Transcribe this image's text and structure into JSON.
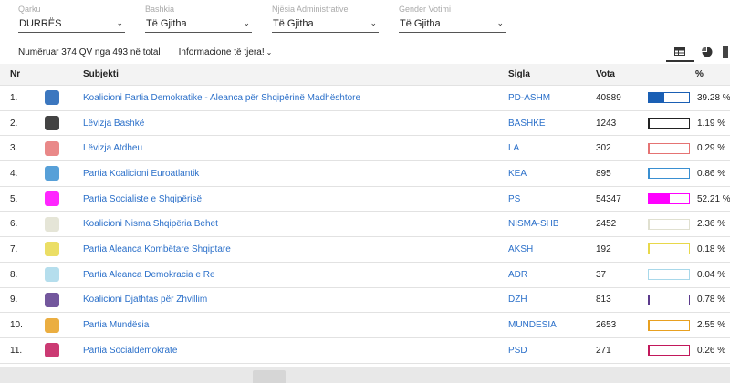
{
  "filters": [
    {
      "label": "Qarku",
      "value": "DURRËS"
    },
    {
      "label": "Bashkia",
      "value": "Të Gjitha"
    },
    {
      "label": "Njësia Administrative",
      "value": "Të Gjitha"
    },
    {
      "label": "Gender Votimi",
      "value": "Të Gjitha"
    }
  ],
  "info": {
    "count_text": "Numëruar 374 QV nga 493 në total",
    "more_label": "Informacione të tjera!"
  },
  "views": [
    "table-view-icon",
    "pie-chart-icon"
  ],
  "table": {
    "headers": {
      "nr": "Nr",
      "subjekti": "Subjekti",
      "sigla": "Sigla",
      "vota": "Vota",
      "pct": "%"
    },
    "rows": [
      {
        "nr": "1.",
        "subjekti": "Koalicioni Partia Demokratike - Aleanca për Shqipërinë Madhështore",
        "sigla": "PD-ASHM",
        "vota": "40889",
        "pct": "39.28 %",
        "share": 0.3928,
        "color": "#1a5fb4",
        "logo": "pd-logo"
      },
      {
        "nr": "2.",
        "subjekti": "Lëvizja Bashkë",
        "sigla": "BASHKE",
        "vota": "1243",
        "pct": "1.19 %",
        "share": 0.0119,
        "color": "#222222",
        "logo": "bashke-logo"
      },
      {
        "nr": "3.",
        "subjekti": "Lëvizja Atdheu",
        "sigla": "LA",
        "vota": "302",
        "pct": "0.29 %",
        "share": 0.0029,
        "color": "#e57373",
        "logo": "la-logo"
      },
      {
        "nr": "4.",
        "subjekti": "Partia Koalicioni Euroatlantik",
        "sigla": "KEA",
        "vota": "895",
        "pct": "0.86 %",
        "share": 0.0086,
        "color": "#3a8fd1",
        "logo": "kea-logo"
      },
      {
        "nr": "5.",
        "subjekti": "Partia Socialiste e Shqipërisë",
        "sigla": "PS",
        "vota": "54347",
        "pct": "52.21 %",
        "share": 0.5221,
        "color": "#ff00ff",
        "logo": "ps-logo"
      },
      {
        "nr": "6.",
        "subjekti": "Koalicioni Nisma Shqipëria Behet",
        "sigla": "NISMA-SHB",
        "vota": "2452",
        "pct": "2.36 %",
        "share": 0.0236,
        "color": "#e0e0d0",
        "logo": "nisma-logo"
      },
      {
        "nr": "7.",
        "subjekti": "Partia Aleanca Kombëtare Shqiptare",
        "sigla": "AKSH",
        "vota": "192",
        "pct": "0.18 %",
        "share": 0.0018,
        "color": "#e8d84a",
        "logo": "aksh-logo"
      },
      {
        "nr": "8.",
        "subjekti": "Partia Aleanca Demokracia e Re",
        "sigla": "ADR",
        "vota": "37",
        "pct": "0.04 %",
        "share": 0.0004,
        "color": "#a8d8ea",
        "logo": "adr-logo"
      },
      {
        "nr": "9.",
        "subjekti": "Koalicioni Djathtas për Zhvillim",
        "sigla": "DZH",
        "vota": "813",
        "pct": "0.78 %",
        "share": 0.0078,
        "color": "#5b3a8c",
        "logo": "dzh-logo"
      },
      {
        "nr": "10.",
        "subjekti": "Partia Mundësia",
        "sigla": "MUNDESIA",
        "vota": "2653",
        "pct": "2.55 %",
        "share": 0.0255,
        "color": "#e8a020",
        "logo": "mundesia-logo"
      },
      {
        "nr": "11.",
        "subjekti": "Partia Socialdemokrate",
        "sigla": "PSD",
        "vota": "271",
        "pct": "0.26 %",
        "share": 0.0026,
        "color": "#c2185b",
        "logo": "psd-logo"
      }
    ]
  }
}
